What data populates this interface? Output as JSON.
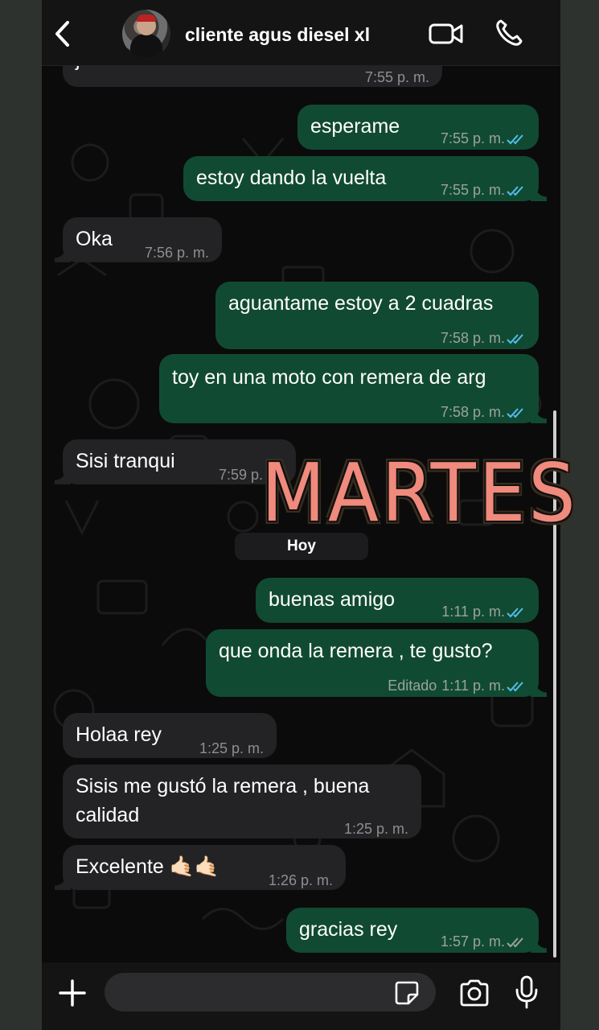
{
  "header": {
    "contact_name": "cliente agus diesel xl"
  },
  "messages": [
    {
      "dir": "in",
      "text": "jeans",
      "time": "7:55 p. m."
    },
    {
      "dir": "out",
      "text": "esperame",
      "time": "7:55 p. m.",
      "status": "read"
    },
    {
      "dir": "out",
      "text": "estoy dando la vuelta",
      "time": "7:55 p. m.",
      "status": "read"
    },
    {
      "dir": "in",
      "text": "Oka",
      "time": "7:56 p. m."
    },
    {
      "dir": "out",
      "text": "aguantame estoy a 2 cuadras",
      "time": "7:58 p. m.",
      "status": "read"
    },
    {
      "dir": "out",
      "text": "toy en una moto con remera de arg",
      "time": "7:58 p. m.",
      "status": "read"
    },
    {
      "dir": "in",
      "text": "Sisi tranqui",
      "time": "7:59 p. m."
    },
    {
      "dir": "out",
      "text": "buenas amigo",
      "time": "1:11 p. m.",
      "status": "read"
    },
    {
      "dir": "out",
      "text": "que onda la remera , te gusto?",
      "time": "1:11 p. m.",
      "edited_label": "Editado",
      "status": "read"
    },
    {
      "dir": "in",
      "text": "Holaa rey",
      "time": "1:25 p. m."
    },
    {
      "dir": "in",
      "text": "Sisis me gustó la remera , buena calidad",
      "time": "1:25 p. m."
    },
    {
      "dir": "in",
      "text": "Excelente 🤙🏻🤙🏻",
      "time": "1:26 p. m."
    },
    {
      "dir": "out",
      "text": "gracias rey",
      "time": "1:57 p. m.",
      "status": "delivered"
    }
  ],
  "day_separator": "Hoy",
  "overlay_sticker": "MARTES",
  "composer": {
    "placeholder": ""
  },
  "colors": {
    "outgoing_bubble": "#114a32",
    "incoming_bubble": "#232325",
    "read_ticks": "#53bdeb",
    "delivered_ticks": "#9aa39d",
    "sticker": "#f08a7d"
  }
}
